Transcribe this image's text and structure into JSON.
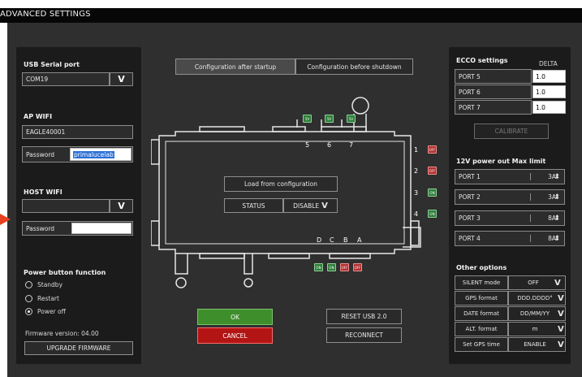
{
  "window": {
    "title": "ADVANCED SETTINGS"
  },
  "colors": {
    "ok": "#3e8e2c",
    "cancel": "#b31414",
    "panel": "#1b1b1b",
    "background": "#2f2f2f",
    "arrow": "#e8401e"
  },
  "left": {
    "usb_label": "USB Serial port",
    "usb_value": "COM19",
    "ap_label": "AP WIFI",
    "ap_ssid": "EAGLE40001",
    "ap_password_label": "Password",
    "ap_password_value": "primalucelab",
    "host_label": "HOST WIFI",
    "host_ssid": "",
    "host_password_label": "Password",
    "host_password_value": "",
    "power_label": "Power button function",
    "power_options": [
      "Standby",
      "Restart",
      "Power off"
    ],
    "power_selected": "Power off",
    "firmware_version": "Firmware version: 04.00",
    "upgrade_button": "UPGRADE FIRMWARE"
  },
  "center": {
    "tab_startup": "Configuration after startup",
    "tab_shutdown": "Configuration before shutdown",
    "load_button": "Load from configuration",
    "status_label": "STATUS",
    "status_value": "DISABLE",
    "top_ports": [
      "5",
      "6",
      "7"
    ],
    "top_led_text": "5V",
    "right_ports": [
      "1",
      "2",
      "3",
      "4"
    ],
    "right_leds": [
      "OFF",
      "OFF",
      "ON",
      "ON"
    ],
    "bottom_ports": [
      "D",
      "C",
      "B",
      "A"
    ],
    "bottom_leds": [
      "ON",
      "ON",
      "OFF",
      "OFF"
    ],
    "ok_button": "OK",
    "cancel_button": "CANCEL",
    "reset_usb_button": "RESET USB 2.0",
    "reconnect_button": "RECONNECT"
  },
  "right": {
    "ecco_label": "ECCO settings",
    "delta_label": "DELTA",
    "ecco_ports": [
      {
        "name": "PORT 5",
        "value": "1.0"
      },
      {
        "name": "PORT 6",
        "value": "1.0"
      },
      {
        "name": "PORT 7",
        "value": "1.0"
      }
    ],
    "calibrate_button": "CALIBRATE",
    "power_label": "12V power out Max limit",
    "power_ports": [
      {
        "name": "PORT 1",
        "value": "3A"
      },
      {
        "name": "PORT 2",
        "value": "3A"
      },
      {
        "name": "PORT 3",
        "value": "8A"
      },
      {
        "name": "PORT 4",
        "value": "8A"
      }
    ],
    "other_label": "Other options",
    "options": [
      {
        "name": "SILENT mode",
        "value": "OFF"
      },
      {
        "name": "GPS format",
        "value": "DDD.DDDD°"
      },
      {
        "name": "DATE format",
        "value": "DD/MM/YY"
      },
      {
        "name": "ALT. format",
        "value": "m"
      },
      {
        "name": "Set GPS time",
        "value": "ENABLE"
      }
    ]
  }
}
